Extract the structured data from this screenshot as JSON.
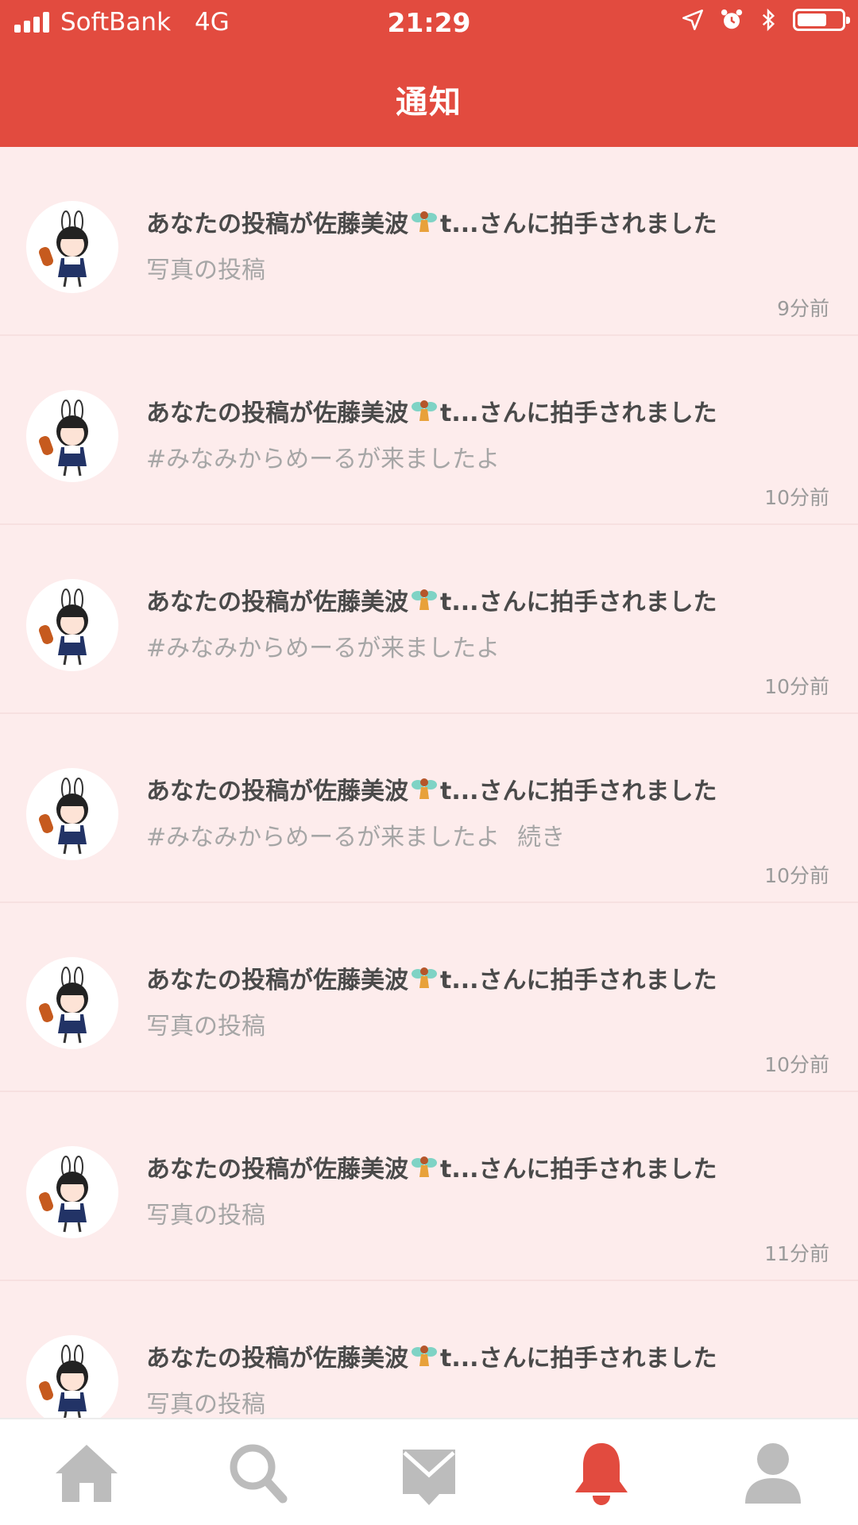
{
  "status_bar": {
    "carrier": "SoftBank",
    "network": "4G",
    "time": "21:29"
  },
  "header": {
    "title": "通知"
  },
  "notifications": [
    {
      "pre": "あなたの投稿が佐藤美波",
      "post": "t...さんに拍手されました",
      "sub": "写真の投稿",
      "more": "",
      "time": "9分前"
    },
    {
      "pre": "あなたの投稿が佐藤美波",
      "post": "t...さんに拍手されました",
      "sub": "#みなみからめーるが来ましたよ",
      "more": "",
      "time": "10分前"
    },
    {
      "pre": "あなたの投稿が佐藤美波",
      "post": "t...さんに拍手されました",
      "sub": "#みなみからめーるが来ましたよ",
      "more": "",
      "time": "10分前"
    },
    {
      "pre": "あなたの投稿が佐藤美波",
      "post": "t...さんに拍手されました",
      "sub": "#みなみからめーるが来ましたよ",
      "more": "続き",
      "time": "10分前"
    },
    {
      "pre": "あなたの投稿が佐藤美波",
      "post": "t...さんに拍手されました",
      "sub": "写真の投稿",
      "more": "",
      "time": "10分前"
    },
    {
      "pre": "あなたの投稿が佐藤美波",
      "post": "t...さんに拍手されました",
      "sub": "写真の投稿",
      "more": "",
      "time": "11分前"
    },
    {
      "pre": "あなたの投稿が佐藤美波",
      "post": "t...さんに拍手されました",
      "sub": "写真の投稿",
      "more": "",
      "time": ""
    }
  ],
  "tabbar": {
    "tabs": [
      {
        "icon": "home-icon",
        "active": false
      },
      {
        "icon": "search-icon",
        "active": false
      },
      {
        "icon": "mail-icon",
        "active": false
      },
      {
        "icon": "bell-icon",
        "active": true
      },
      {
        "icon": "profile-icon",
        "active": false
      }
    ]
  },
  "colors": {
    "accent": "#e24b3f",
    "list_background": "#fdecec",
    "tab_inactive": "#bcbcbc"
  }
}
